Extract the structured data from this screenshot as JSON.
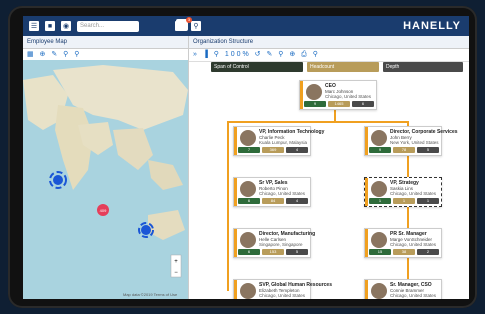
{
  "app": {
    "logo": "HANELLY"
  },
  "topbar": {
    "search_placeholder": "Search...",
    "notif_count": "3"
  },
  "left_panel": {
    "tab": "Employee Map",
    "map_attribution": "Map data ©2019  Terms of Use"
  },
  "right_panel": {
    "tab": "Organization Structure",
    "zoom": "100%",
    "filters": [
      "Span of Control",
      "Headcount",
      "Depth"
    ]
  },
  "cards": [
    {
      "id": "ceo",
      "title": "CEO",
      "name": "Marc Johnson",
      "loc": "Chicago, United States",
      "stats": [
        "9",
        "1465",
        "6"
      ]
    },
    {
      "id": "vp-it",
      "title": "VP, Information Technology",
      "name": "Charlie Peck",
      "loc": "Kuala Lumpur, Malaysia",
      "stats": [
        "7",
        "369",
        "4"
      ]
    },
    {
      "id": "dir-corp",
      "title": "Director, Corporate Services",
      "name": "John Berry",
      "loc": "New York, United States",
      "stats": [
        "9",
        "78",
        "5"
      ]
    },
    {
      "id": "svp-sales",
      "title": "Sr VP, Sales",
      "name": "Roberto Pinon",
      "loc": "Chicago, United States",
      "stats": [
        "6",
        "84",
        "4"
      ]
    },
    {
      "id": "vp-strat",
      "title": "VP, Strategy",
      "name": "Saskia Lins",
      "loc": "Chicago, United States",
      "stats": [
        "1",
        "1",
        "1"
      ]
    },
    {
      "id": "dir-mfg",
      "title": "Director, Manufacturing",
      "name": "Helle Carlsen",
      "loc": "Singapore, Singapore",
      "stats": [
        "6",
        "153",
        "5"
      ]
    },
    {
      "id": "pr-mgr",
      "title": "PR Sr. Manager",
      "name": "Marge VonSchneider",
      "loc": "Chicago, United States",
      "stats": [
        "15",
        "38",
        "2"
      ]
    },
    {
      "id": "svp-hr",
      "title": "SVP, Global Human Resources",
      "name": "Elizabeth Templeton",
      "loc": "Chicago, United States",
      "stats": [
        "",
        "",
        ""
      ]
    },
    {
      "id": "sr-csm",
      "title": "Sr. Manager, CSO",
      "name": "Connie Brammer",
      "loc": "Chicago, United States",
      "stats": [
        "",
        "",
        ""
      ]
    }
  ]
}
